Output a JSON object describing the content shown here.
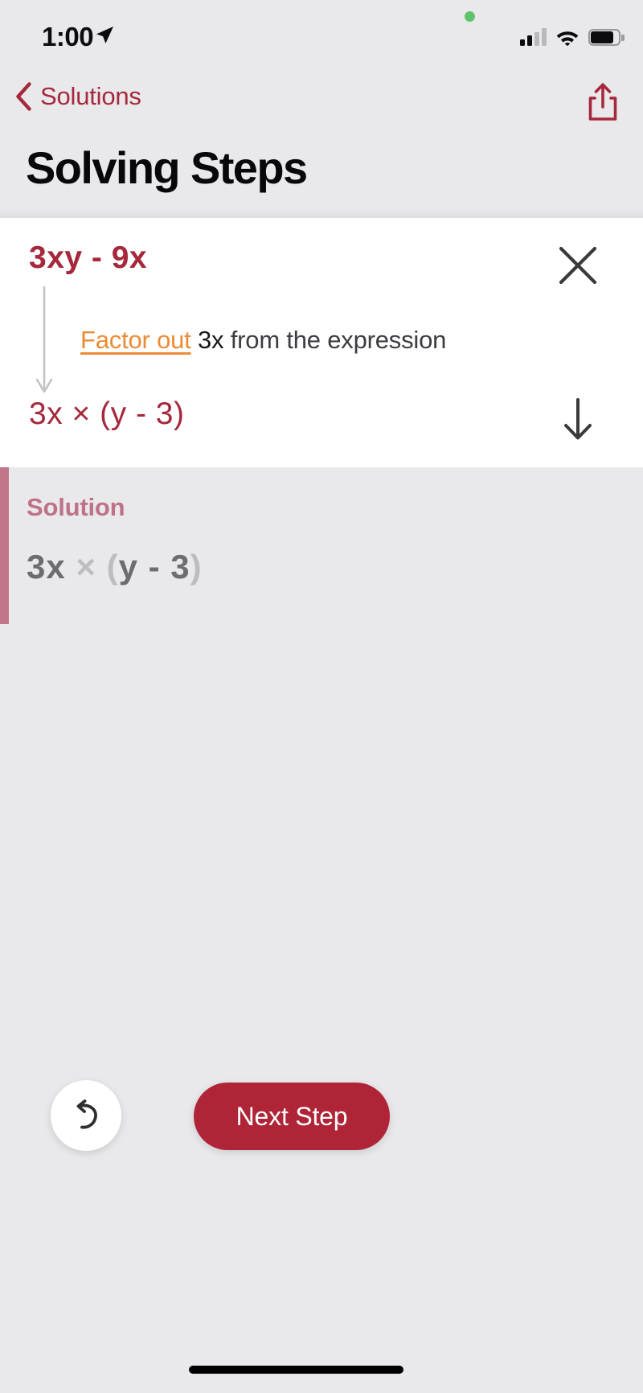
{
  "status_bar": {
    "time": "1:00",
    "location_icon": "location-arrow-icon",
    "privacy_indicator": "green-recording-dot",
    "cellular_icon": "cellular-signal-icon",
    "wifi_icon": "wifi-icon",
    "battery_icon": "battery-icon"
  },
  "nav_bar": {
    "back_label": "Solutions",
    "back_icon": "chevron-left-icon",
    "share_icon": "share-icon"
  },
  "header": {
    "title": "Solving Steps"
  },
  "step_card": {
    "expression": "3xy - 9x",
    "close_icon": "close-x-icon",
    "flow_arrow_icon": "flow-down-arrow-icon",
    "description_action": "Factor out",
    "description_math": "3x",
    "description_rest": " from the expression",
    "result": "3x × (y - 3)",
    "next_arrow_icon": "arrow-down-icon"
  },
  "solution": {
    "label": "Solution",
    "expression_prefix": "3x",
    "expression_times": " × ",
    "expression_paren_open": "(",
    "expression_inner": "y - 3",
    "expression_paren_close": ")"
  },
  "bottom_actions": {
    "undo_icon": "undo-arrow-icon",
    "next_step_label": "Next Step"
  },
  "colors": {
    "brand_crimson": "#a6283c",
    "button_crimson": "#b02437",
    "accent_orange": "#ec8b35",
    "solution_rose": "#bf7187",
    "solution_bar": "#c1768a",
    "background_gray": "#e9e9eb",
    "card_white": "#ffffff",
    "solution_text_gray": "#6d6d70",
    "solution_dim_gray": "#bdbdc0",
    "icon_dark": "#3a3a3c",
    "privacy_green": "#5ec36a"
  }
}
